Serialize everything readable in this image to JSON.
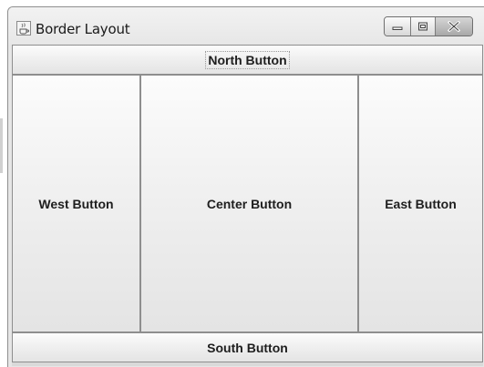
{
  "window": {
    "title": "Border Layout",
    "app_icon": "java-cup-icon",
    "controls": {
      "minimize_icon": "minimize-icon",
      "maximize_icon": "maximize-icon",
      "close_icon": "close-icon"
    }
  },
  "buttons": {
    "north": "North Button",
    "west": "West Button",
    "center": "Center Button",
    "east": "East Button",
    "south": "South Button"
  },
  "colors": {
    "button_border": "#8e8e8e",
    "window_bg": "#e6e6e6",
    "text": "#1e1e1e"
  }
}
